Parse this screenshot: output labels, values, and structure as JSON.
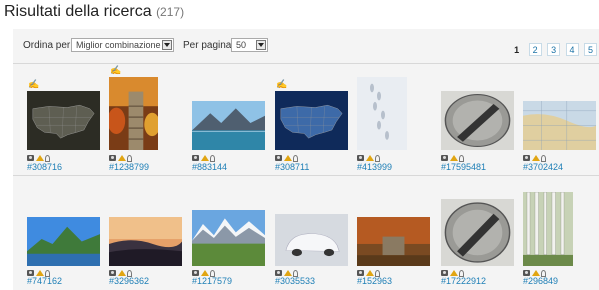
{
  "header": {
    "title": "Risultati della ricerca",
    "count": "(217)"
  },
  "toolbar": {
    "sort_label": "Ordina per",
    "sort_value": "Miglior combinazione",
    "perpage_label": "Per pagina",
    "perpage_value": "50"
  },
  "pagination": {
    "current": "1",
    "links": [
      "2",
      "3",
      "4",
      "5"
    ]
  },
  "results": [
    {
      "id": "#308716",
      "subject": "us-map-dark",
      "featured": true
    },
    {
      "id": "#1238799",
      "subject": "autumn-stairs",
      "featured": true
    },
    {
      "id": "#883144",
      "subject": "mountain-lake"
    },
    {
      "id": "#308711",
      "subject": "us-map-blue",
      "featured": true
    },
    {
      "id": "#413999",
      "subject": "snow-footprints"
    },
    {
      "id": "#17595481",
      "subject": "sundial"
    },
    {
      "id": "#3702424",
      "subject": "globe-map"
    },
    {
      "id": "#747162",
      "subject": "coastal-mountains"
    },
    {
      "id": "#3296362",
      "subject": "sunset-hills"
    },
    {
      "id": "#1217579",
      "subject": "snowy-peaks-meadow"
    },
    {
      "id": "#3035533",
      "subject": "snow-covered-car"
    },
    {
      "id": "#152963",
      "subject": "autumn-garden"
    },
    {
      "id": "#17222912",
      "subject": "sundial"
    },
    {
      "id": "#296849",
      "subject": "birch-forest"
    }
  ],
  "icon_set": [
    "camera-icon",
    "crown-icon",
    "key-icon"
  ],
  "colors": {
    "link": "#1e7fb6",
    "accent": "#e1a512"
  }
}
